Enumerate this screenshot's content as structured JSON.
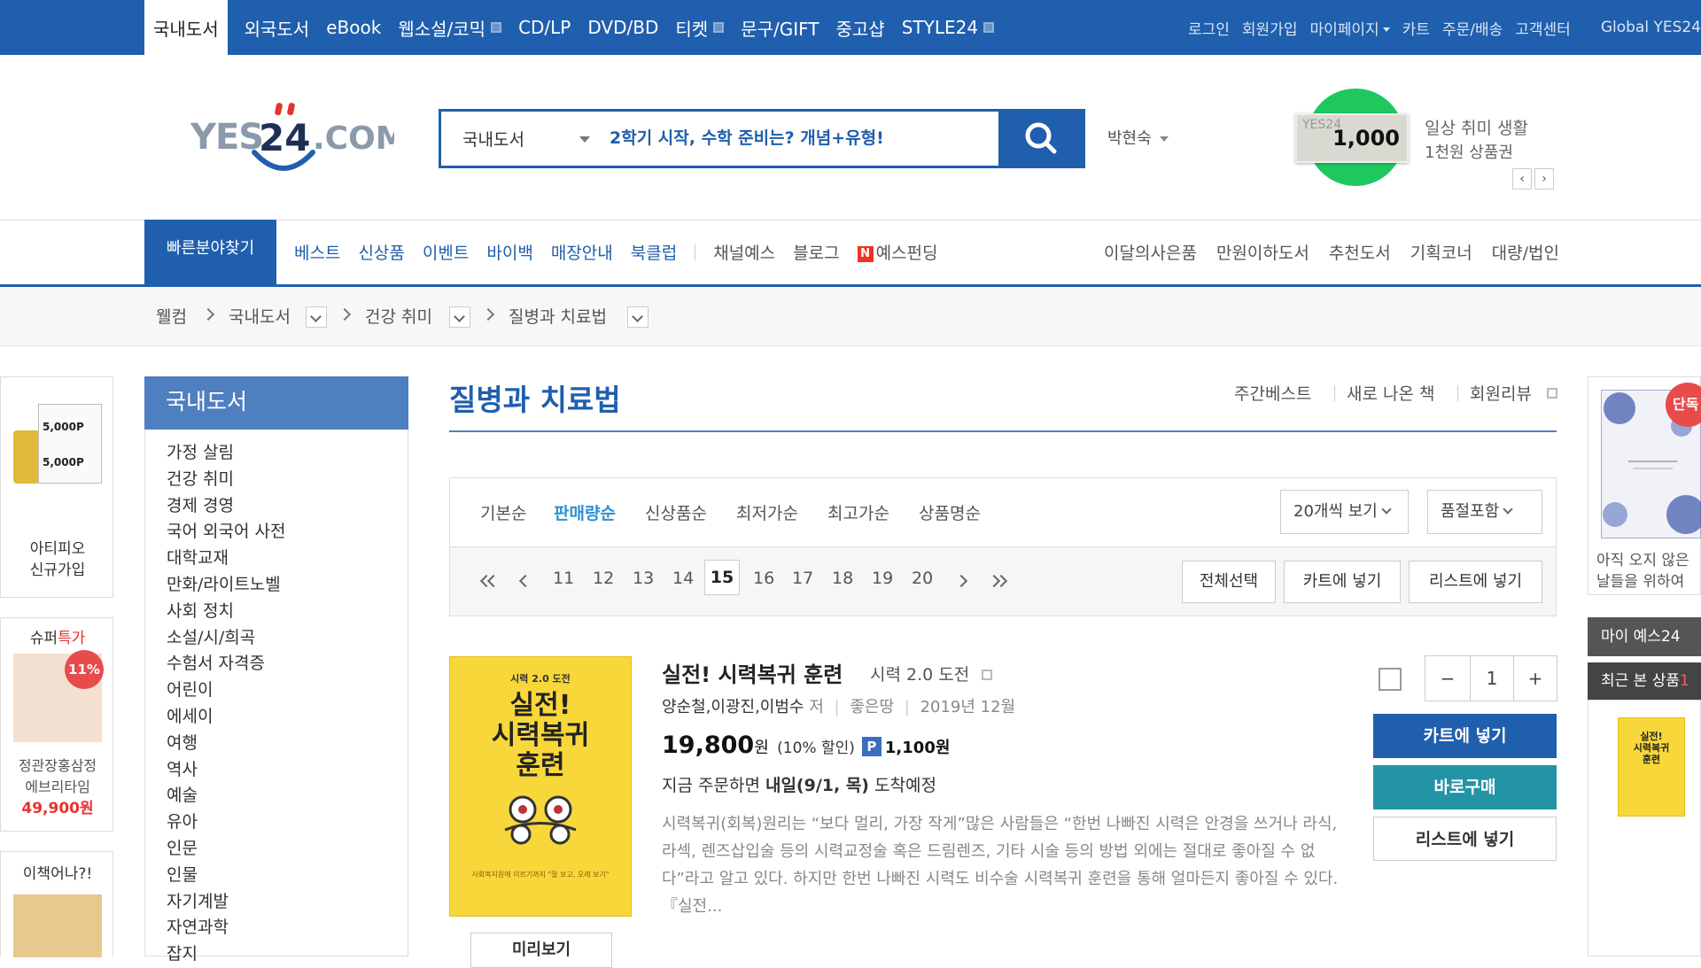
{
  "topnav": {
    "items": [
      "국내도서",
      "외국도서",
      "eBook",
      "웹소설/코믹",
      "CD/LP",
      "DVD/BD",
      "티켓",
      "문구/GIFT",
      "중고샵",
      "STYLE24"
    ],
    "util": [
      "로그인",
      "회원가입",
      "마이페이지",
      "카트",
      "주문/배송",
      "고객센터",
      "Global YES24"
    ]
  },
  "header": {
    "logo_text": "YES24.COM",
    "search_category": "국내도서",
    "search_placeholder": "2학기 시작, 수학 준비는? 개념+유형!",
    "user_name": "박현숙",
    "banner_value": "1,000",
    "banner_watermark": "YES24",
    "banner_line1": "일상 취미 생활",
    "banner_line2": "1천원 상품권",
    "accent": "#1f5fad",
    "banner_green": "#1ec85f"
  },
  "catnav": {
    "quick": "빠른분야찾기",
    "links_blue": [
      "베스트",
      "신상품",
      "이벤트",
      "바이백",
      "매장안내",
      "북클럽"
    ],
    "links_gray": [
      "채널예스",
      "블로그"
    ],
    "funding_badge": "N",
    "funding": "예스펀딩",
    "right": [
      "이달의사은품",
      "만원이하도서",
      "추천도서",
      "기획코너",
      "대량/법인"
    ]
  },
  "breadcrumb": [
    "웰컴",
    "국내도서",
    "건강 취미",
    "질병과 치료법"
  ],
  "left_promos": {
    "coin_label_top": "5,000P",
    "coin_label_bottom": "5,000P",
    "promo1_line1": "아티피오",
    "promo1_line2": "신규가입",
    "promo2_title_a": "슈퍼",
    "promo2_title_b": "특가",
    "promo2_badge": "11%",
    "promo2_line1": "정관장홍삼정",
    "promo2_line2": "에브리타임",
    "promo2_price": "49,900원",
    "promo3_title": "이책어나?!"
  },
  "sidebar": {
    "title": "국내도서",
    "items": [
      "가정 살림",
      "건강 취미",
      "경제 경영",
      "국어 외국어 사전",
      "대학교재",
      "만화/라이트노벨",
      "사회 정치",
      "소설/시/희곡",
      "수험서 자격증",
      "어린이",
      "에세이",
      "여행",
      "역사",
      "예술",
      "유아",
      "인문",
      "인물",
      "자기계발",
      "자연과학",
      "잡지"
    ]
  },
  "main": {
    "title": "질병과 치료법",
    "title_links": [
      "주간베스트",
      "새로 나온 책",
      "회원리뷰"
    ],
    "sort_options": [
      "기본순",
      "판매량순",
      "신상품순",
      "최저가순",
      "최고가순",
      "상품명순"
    ],
    "sort_active_index": 1,
    "per_page": "20개씩 보기",
    "stock": "품절포함",
    "pages": [
      "11",
      "12",
      "13",
      "14",
      "15",
      "16",
      "17",
      "18",
      "19",
      "20"
    ],
    "current_page": "15",
    "select_all": "전체선택",
    "add_cart": "카트에 넣기",
    "add_list": "리스트에 넣기"
  },
  "product": {
    "cover_line1": "시력 2.0 도전",
    "cover_line2": "실전!",
    "cover_line3": "시력복귀",
    "cover_line4": "훈련",
    "cover_bottom": "사회복지원에 이르기까지 \"잘 보고, 오래 보기\"",
    "title": "실전! 시력복귀 훈련",
    "subtitle": "시력 2.0 도전",
    "authors": "양순철,이광진,이범수",
    "author_suffix": "저",
    "publisher": "좋은땅",
    "date": "2019년 12월",
    "price": "19,800",
    "price_unit": "원",
    "discount": "(10% 할인)",
    "points_badge": "P",
    "points": "1,100원",
    "delivery_pre": "지금 주문하면",
    "delivery_date": "내일(9/1, 목)",
    "delivery_post": "도착예정",
    "description": "시력복귀(회복)원리는 “보다 멀리, 가장 작게”많은 사람들은 “한번 나빠진 시력은 안경을 쓰거나 라식, 라섹, 렌즈삽입술 등의 시력교정술 혹은 드림렌즈, 기타 시술 등의 방법 외에는 절대로 좋아질 수 없다”라고 알고 있다. 하지만 한번 나빠진 시력도 비수술 시력복귀 훈련을 통해 얼마든지 좋아질 수 있다. 『실전...",
    "qty": "1",
    "qty_minus": "−",
    "qty_plus": "+",
    "btn_cart": "카트에 넣기",
    "btn_buy": "바로구매",
    "btn_list": "리스트에 넣기",
    "preview": "미리보기"
  },
  "right_sidebar": {
    "badge": "단독",
    "text1": "아직 오지 않은",
    "text2": "날들을 위하여",
    "my_yes": "마이 예스24",
    "recent": "최근 본 상품",
    "recent_count": "1"
  }
}
